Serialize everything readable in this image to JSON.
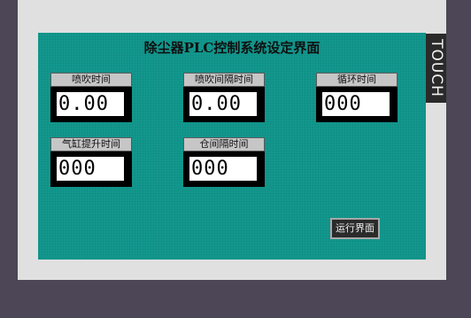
{
  "screen": {
    "title": "除尘器PLC控制系统设定界面",
    "touch_label": "TOUCH"
  },
  "fields": [
    {
      "label": "喷吹时间",
      "value": "0.00"
    },
    {
      "label": "喷吹间隔时间",
      "value": "0.00"
    },
    {
      "label": "循环时间",
      "value": "000"
    },
    {
      "label": "气缸提升时间",
      "value": "000"
    },
    {
      "label": "仓间隔时间",
      "value": "000"
    }
  ],
  "buttons": {
    "run_label": "运行界面"
  }
}
